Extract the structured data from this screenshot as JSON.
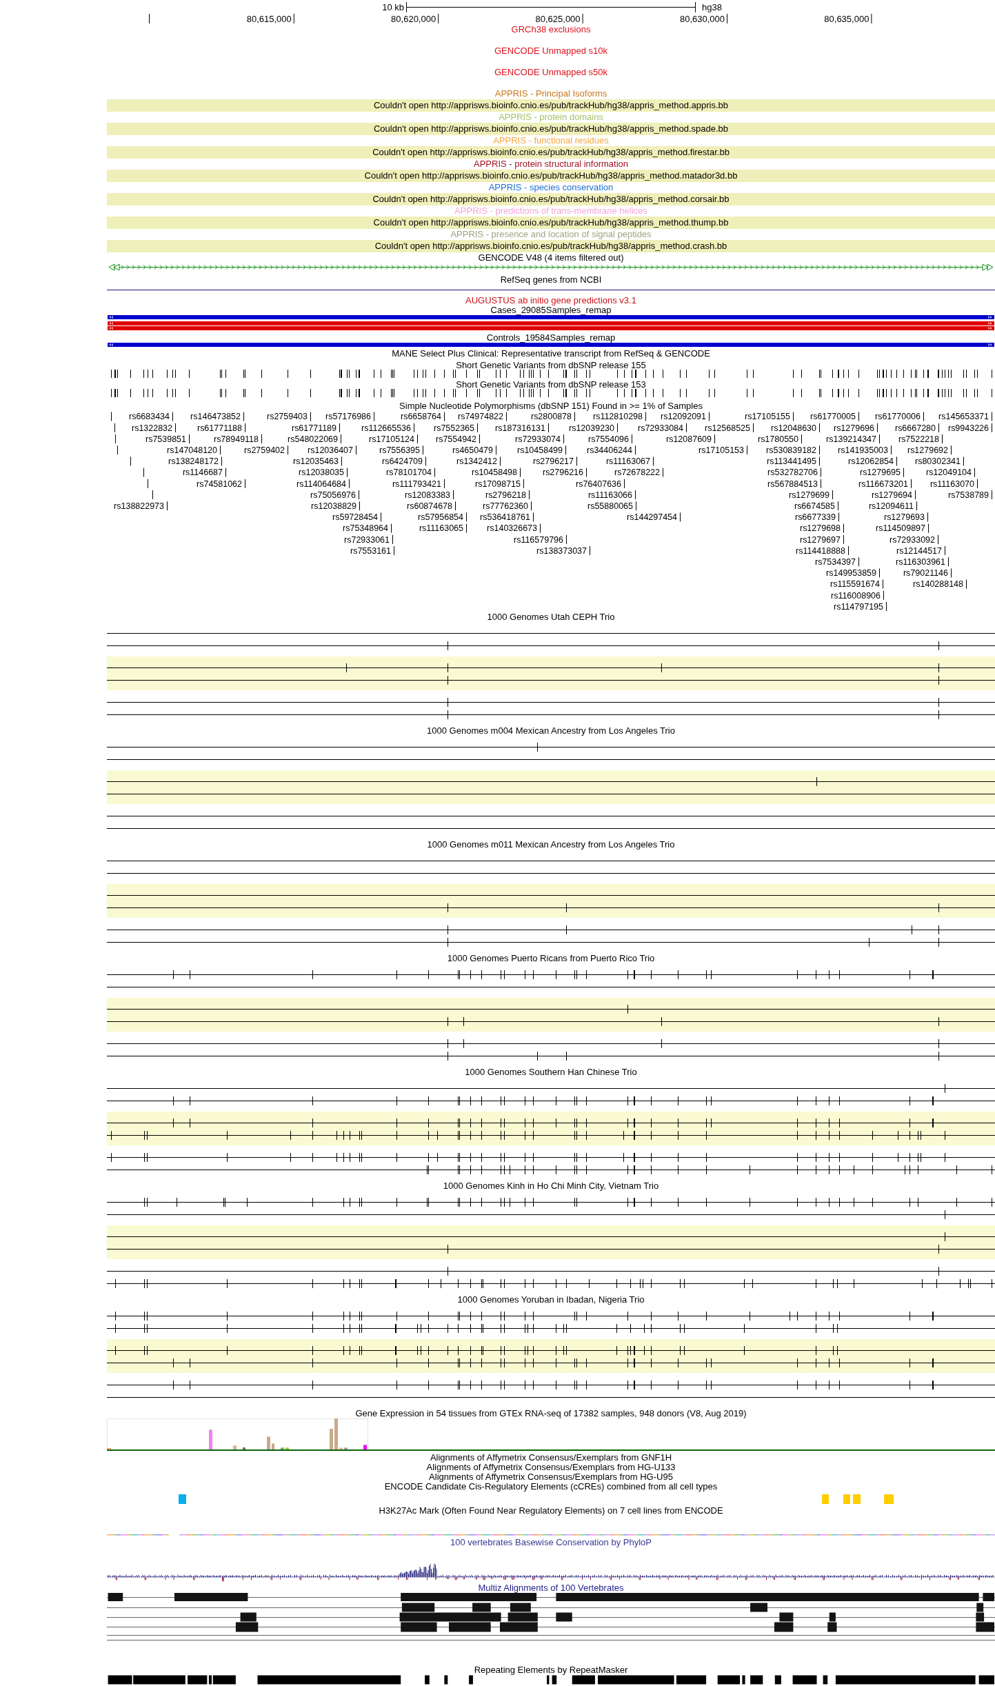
{
  "ruler": {
    "scale": "10 kb",
    "assembly": "hg38",
    "positions": [
      "80,615,000",
      "80,620,000",
      "80,625,000",
      "80,630,000",
      "80,635,000"
    ]
  },
  "tracks": [
    {
      "kind": "blank",
      "title": "GRCh38 exclusions",
      "color": "#e0101a"
    },
    {
      "kind": "blank",
      "title": "GENCODE Unmapped s10k",
      "color": "#e0101a"
    },
    {
      "kind": "blank",
      "title": "GENCODE Unmapped s50k",
      "color": "#e0101a"
    },
    {
      "kind": "error",
      "title": "APPRIS - Principal Isoforms",
      "color": "#c8781e",
      "message": "Couldn't open http://apprisws.bioinfo.cnio.es/pub/trackHub/hg38/appris_method.appris.bb"
    },
    {
      "kind": "error",
      "title": "APPRIS - protein domains",
      "color": "#a5c06b",
      "message": "Couldn't open http://apprisws.bioinfo.cnio.es/pub/trackHub/hg38/appris_method.spade.bb"
    },
    {
      "kind": "error",
      "title": "APPRIS - functional residues",
      "color": "#f4a742",
      "message": "Couldn't open http://apprisws.bioinfo.cnio.es/pub/trackHub/hg38/appris_method.firestar.bb"
    },
    {
      "kind": "error",
      "title": "APPRIS - protein structural information",
      "color": "#9e0d1d",
      "message": "Couldn't open http://apprisws.bioinfo.cnio.es/pub/trackHub/hg38/appris_method.matador3d.bb"
    },
    {
      "kind": "error",
      "title": "APPRIS - species conservation",
      "color": "#1f6fd6",
      "message": "Couldn't open http://apprisws.bioinfo.cnio.es/pub/trackHub/hg38/appris_method.corsair.bb"
    },
    {
      "kind": "error",
      "title": "APPRIS - predictions of trans-membrane helices",
      "color": "#f4a6d8",
      "message": "Couldn't open http://apprisws.bioinfo.cnio.es/pub/trackHub/hg38/appris_method.thump.bb"
    },
    {
      "kind": "error",
      "title": "APPRIS - presence and location of signal peptides",
      "color": "#a3a383",
      "message": "Couldn't open http://apprisws.bioinfo.cnio.es/pub/trackHub/hg38/appris_method.crash.bb"
    },
    {
      "kind": "gene",
      "title": "GENCODE V48 (4 items filtered out)",
      "color": "#000000"
    },
    {
      "kind": "line",
      "title": "RefSeq genes from NCBI",
      "color": "#000000"
    },
    {
      "kind": "title",
      "title": "AUGUSTUS ab initio gene predictions v3.1",
      "color": "#cc1418"
    },
    {
      "kind": "bars",
      "title": "Cases_29085Samples_remap",
      "color": "#000000",
      "bars": [
        {
          "color": "#0000d0"
        },
        {
          "color": "#e00000"
        },
        {
          "color": "#e00000"
        }
      ]
    },
    {
      "kind": "bars",
      "title": "Controls_19584Samples_remap",
      "color": "#000000",
      "bars": [
        {
          "color": "#0000d0"
        }
      ]
    },
    {
      "kind": "title",
      "title": "MANE Select Plus Clinical: Representative transcript from RefSeq & GENCODE",
      "color": "#000000"
    },
    {
      "kind": "ticks",
      "title": "Short Genetic Variants from dbSNP release 155",
      "color": "#000000"
    },
    {
      "kind": "ticks",
      "title": "Short Genetic Variants from dbSNP release 153",
      "color": "#000000"
    },
    {
      "kind": "snps",
      "title": "Simple Nucleotide Polymorphisms (dbSNP 151) Found in >= 1% of Samples",
      "color": "#000000",
      "labels": [
        "rs6683434",
        "rs146473852",
        "rs2759403",
        "rs57176986",
        "rs6658764",
        "rs74974822",
        "rs2800878",
        "rs112810298",
        "rs12092091",
        "rs17105155",
        "rs61770005",
        "rs61770006",
        "rs145653371",
        "rs1322832",
        "rs61771188",
        "rs61771189",
        "rs112665536",
        "rs7552365",
        "rs187316131",
        "rs12039230",
        "rs72933084",
        "rs12568525",
        "rs12048630",
        "rs1279696",
        "rs6667280",
        "rs9943226",
        "rs7539851",
        "rs78949118",
        "rs548022069",
        "rs17105124",
        "rs7554942",
        "rs72933074",
        "rs7554096",
        "rs12087609",
        "rs1780550",
        "rs139214347",
        "rs7522218",
        "rs147048120",
        "rs2759402",
        "rs12036407",
        "rs7556395",
        "rs4650479",
        "rs10458499",
        "rs34406244",
        "rs17105153",
        "rs530839182",
        "rs141935003",
        "rs1279692",
        "rs138248172",
        "rs12035463",
        "rs6424709",
        "rs1342412",
        "rs2796217",
        "rs11163067",
        "rs113441495",
        "rs12062854",
        "rs80302341",
        "rs1146687",
        "rs12038035",
        "rs78101704",
        "rs10458498",
        "rs2796216",
        "rs72678222",
        "rs532782706",
        "rs1279695",
        "rs12049104",
        "rs74581062",
        "rs114064684",
        "rs111793421",
        "rs17098715",
        "rs76407636",
        "rs567884513",
        "rs116673201",
        "rs11163070",
        "rs75056976",
        "rs12083383",
        "rs2796218",
        "rs11163066",
        "rs1279699",
        "rs1279694",
        "rs7538789",
        "rs138822973",
        "rs12038829",
        "rs60874678",
        "rs77762360",
        "rs55880065",
        "rs6674585",
        "rs12094611",
        "rs59728454",
        "rs57956854",
        "rs536418761",
        "rs144297454",
        "rs6677339",
        "rs1279693",
        "rs75348964",
        "rs11163065",
        "rs140326673",
        "rs1279698",
        "rs114509897",
        "rs72933061",
        "rs116579796",
        "rs1279697",
        "rs72933092",
        "rs7553161",
        "rs138373037",
        "rs114418888",
        "rs12144517",
        "rs7534397",
        "rs116303961",
        "rs149953859",
        "rs79021146",
        "rs115591674",
        "rs140288148",
        "rs116008906",
        "rs114797195"
      ]
    },
    {
      "kind": "trio",
      "title": "1000 Genomes Utah CEPH Trio",
      "color": "#000000"
    },
    {
      "kind": "trio",
      "title": "1000 Genomes m004 Mexican Ancestry from Los Angeles Trio",
      "color": "#000000"
    },
    {
      "kind": "trio",
      "title": "1000 Genomes m011 Mexican Ancestry from Los Angeles Trio",
      "color": "#000000"
    },
    {
      "kind": "trio",
      "title": "1000 Genomes Puerto Ricans from Puerto Rico Trio",
      "color": "#000000"
    },
    {
      "kind": "trio",
      "title": "1000 Genomes Southern Han Chinese Trio",
      "color": "#000000"
    },
    {
      "kind": "trio",
      "title": "1000 Genomes Kinh in Ho Chi Minh City, Vietnam Trio",
      "color": "#000000"
    },
    {
      "kind": "trio",
      "title": "1000 Genomes Yoruban in Ibadan, Nigeria Trio",
      "color": "#000000"
    },
    {
      "kind": "gtex",
      "title": "Gene Expression in 54 tissues from GTEx RNA-seq of 17382 samples, 948 donors (V8, Aug 2019)",
      "color": "#000000"
    },
    {
      "kind": "title",
      "title": "Alignments of Affymetrix Consensus/Exemplars from GNF1H",
      "color": "#000000"
    },
    {
      "kind": "title",
      "title": "Alignments of Affymetrix Consensus/Exemplars from HG-U133",
      "color": "#000000"
    },
    {
      "kind": "title",
      "title": "Alignments of Affymetrix Consensus/Exemplars from HG-U95",
      "color": "#000000"
    },
    {
      "kind": "ccre",
      "title": "ENCODE Candidate Cis-Regulatory Elements (cCREs) combined from all cell types",
      "color": "#000000",
      "elements": [
        {
          "color": "#06aeef"
        },
        {
          "color": "#ffcd00"
        },
        {
          "color": "#ffcd00"
        },
        {
          "color": "#ffcd00"
        },
        {
          "color": "#ffcd00"
        }
      ]
    },
    {
      "kind": "signal",
      "title": "H3K27Ac Mark (Often Found Near Regulatory Elements) on 7 cell lines from ENCODE",
      "color": "#000000"
    },
    {
      "kind": "phylop",
      "title": "100 vertebrates Basewise Conservation by PhyloP",
      "color": "#3a3a96"
    },
    {
      "kind": "multiz",
      "title": "Multiz Alignments of 100 Vertebrates",
      "color": "#1c1c8c"
    },
    {
      "kind": "repeats",
      "title": "Repeating Elements by RepeatMasker",
      "color": "#000000"
    }
  ]
}
